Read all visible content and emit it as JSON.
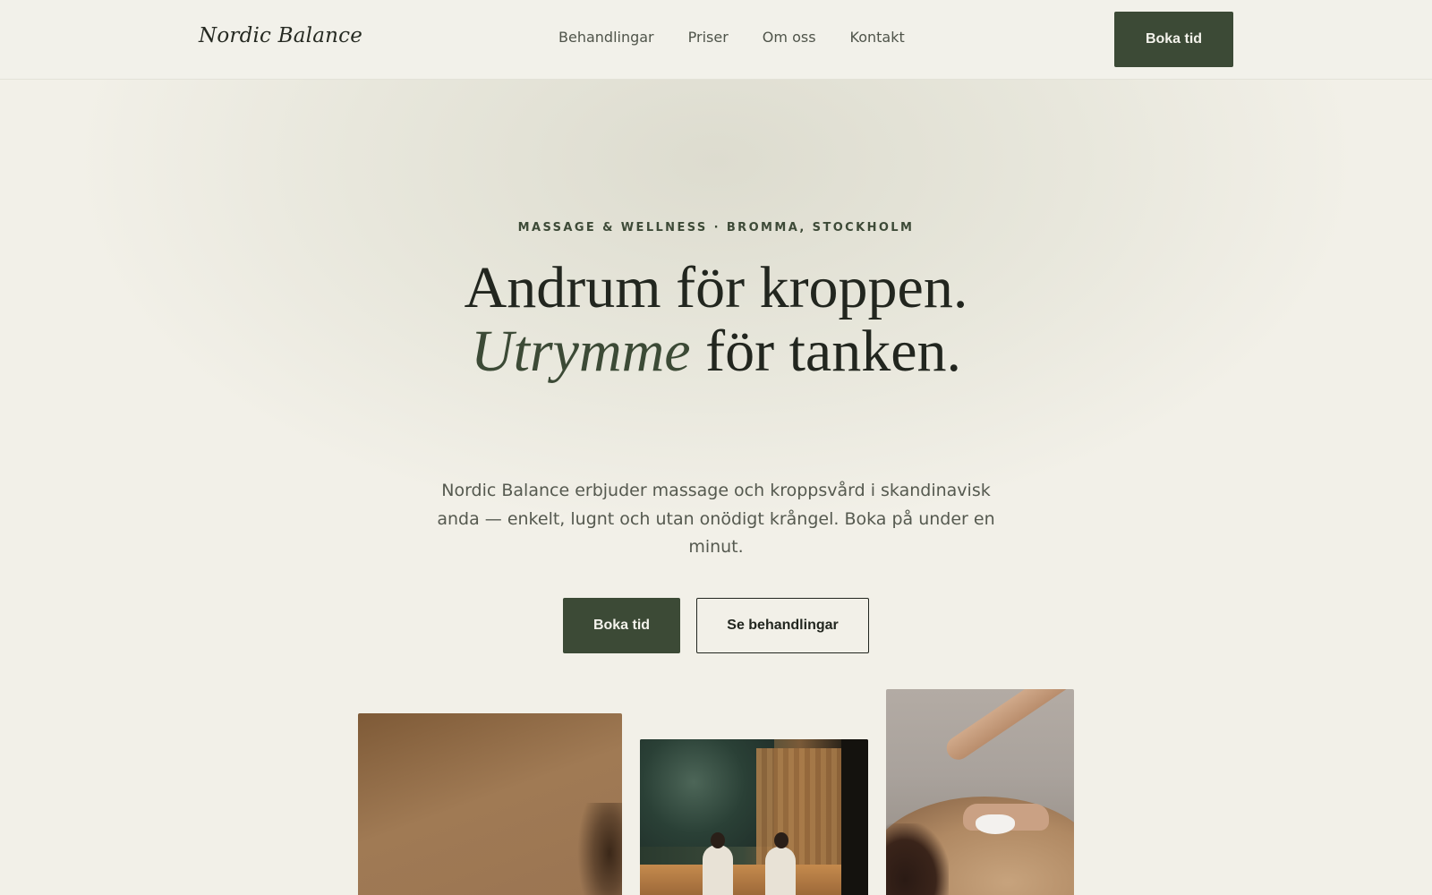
{
  "header": {
    "logo": "Nordic Balance",
    "nav": [
      "Behandlingar",
      "Priser",
      "Om oss",
      "Kontakt"
    ],
    "cta_label": "Boka tid"
  },
  "hero": {
    "eyebrow": "MASSAGE & WELLNESS · BROMMA, STOCKHOLM",
    "headline_part1": "Andrum för kroppen. ",
    "headline_accent": "Utrymme",
    "headline_part2": " för tanken.",
    "lead": "Nordic Balance erbjuder massage och kroppsvård i skandinavisk anda — enkelt, lugnt och utan onödigt krångel. Boka på under en minut.",
    "primary_button": "Boka tid",
    "secondary_button": "Se behandlingar"
  },
  "colors": {
    "accent": "#3c4a36",
    "background": "#f2f0e8",
    "text": "#22261f"
  },
  "images": [
    "massage-warm-toned-photo",
    "sauna-couple-photo",
    "hot-stone-massage-photo"
  ]
}
